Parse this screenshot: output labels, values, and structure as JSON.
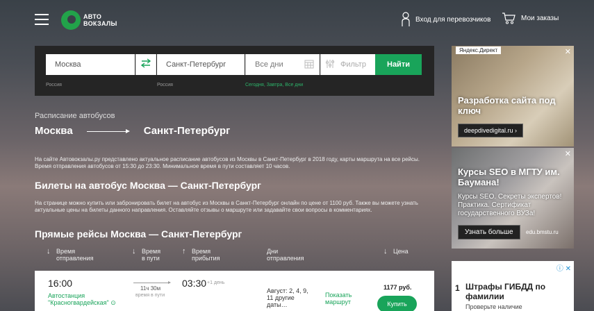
{
  "header": {
    "logo_line1": "АВТО",
    "logo_line2": "ВОКЗАЛЫ",
    "carrier_login": "Вход для перевозчиков",
    "my_orders": "Мои заказы"
  },
  "search": {
    "from_value": "Москва",
    "from_country": "Россия",
    "to_value": "Санкт-Петербург",
    "to_country": "Россия",
    "date_placeholder": "Все дни",
    "date_hint": "Сегодня, Завтра, Все дни",
    "filter_placeholder": "Фильтр",
    "find_label": "Найти"
  },
  "page": {
    "subtitle": "Расписание автобусов",
    "route_from": "Москва",
    "route_to": "Санкт-Петербург",
    "intro": "На сайте Автовокзалы.ру представлено актуальное расписание автобусов из Москвы в Санкт-Петербург в 2018 году, карты маршрута на все рейсы. Время отправления автобусов от 15:30 до 23:30. Минимальное время в пути составляет 10 часов.",
    "tickets_heading": "Билеты на автобус Москва — Санкт-Петербург",
    "tickets_text": "На странице можно купить или забронировать билет на автобус из Москвы в Санкт-Петербург онлайн по цене от 1100 руб. Также вы можете узнать актуальные цены на билеты данного направления. Оставляйте отзывы о маршруте или задавайте свои вопросы в комментариях.",
    "direct_heading": "Прямые рейсы Москва — Санкт-Петербург"
  },
  "table": {
    "columns": [
      {
        "label1": "Время",
        "label2": "отправления",
        "arrow": "↓"
      },
      {
        "label1": "Время",
        "label2": "в пути",
        "arrow": "↓"
      },
      {
        "label1": "Время",
        "label2": "прибытия",
        "arrow": "↑"
      },
      {
        "label1": "Дни",
        "label2": "отправления",
        "arrow": ""
      },
      {
        "label1": "Цена",
        "label2": "",
        "arrow": "↓"
      }
    ],
    "row": {
      "departure": "16:00",
      "station1": "Автостанция",
      "station2": "\"Красногвардейская\"",
      "duration": "11ч 30м",
      "duration_label": "время в пути",
      "arrival": "03:30",
      "arrival_note": "+1 день",
      "days": "Август: 2, 4, 9, 11 другие даты…",
      "show_route1": "Показать",
      "show_route2": "маршрут",
      "price": "1177 руб.",
      "buy_label": "Купить"
    }
  },
  "ads": {
    "ad1": {
      "tag": "Яндекс.Директ",
      "title": "Разработка сайта под ключ",
      "link": "deepdivedigital.ru ›"
    },
    "ad2": {
      "title": "Курсы SEO в МГТУ им. Баумана!",
      "text": "Курсы SEO. Секреты экспертов! Практика. Сертификат государственного ВУЗа!",
      "button": "Узнать больше",
      "domain": "edu.bmstu.ru"
    },
    "ad3": {
      "num": "1",
      "title": "Штрафы ГИБДД по фамилии",
      "sub": "Проверьте наличие"
    }
  },
  "colors": {
    "accent": "#19a45a",
    "panel": "#252525"
  }
}
